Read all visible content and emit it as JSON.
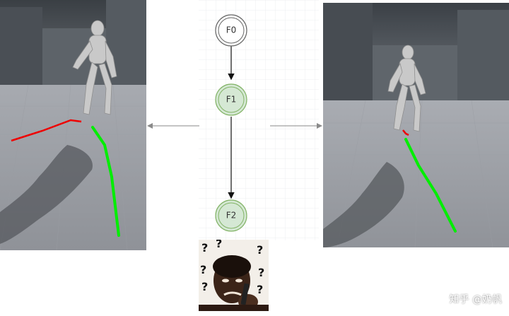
{
  "nodes": {
    "f0": "F0",
    "f1": "F1",
    "f2": "F2"
  },
  "watermark": "知乎 @奶帆",
  "colors": {
    "node_f0_fill": "#ffffff",
    "node_active_fill": "#d5e8d4",
    "node_active_stroke": "#82b366",
    "trajectory_current": "#00ee00",
    "trajectory_predicted": "#ee0000"
  },
  "icons": {
    "question_mark": "?"
  }
}
